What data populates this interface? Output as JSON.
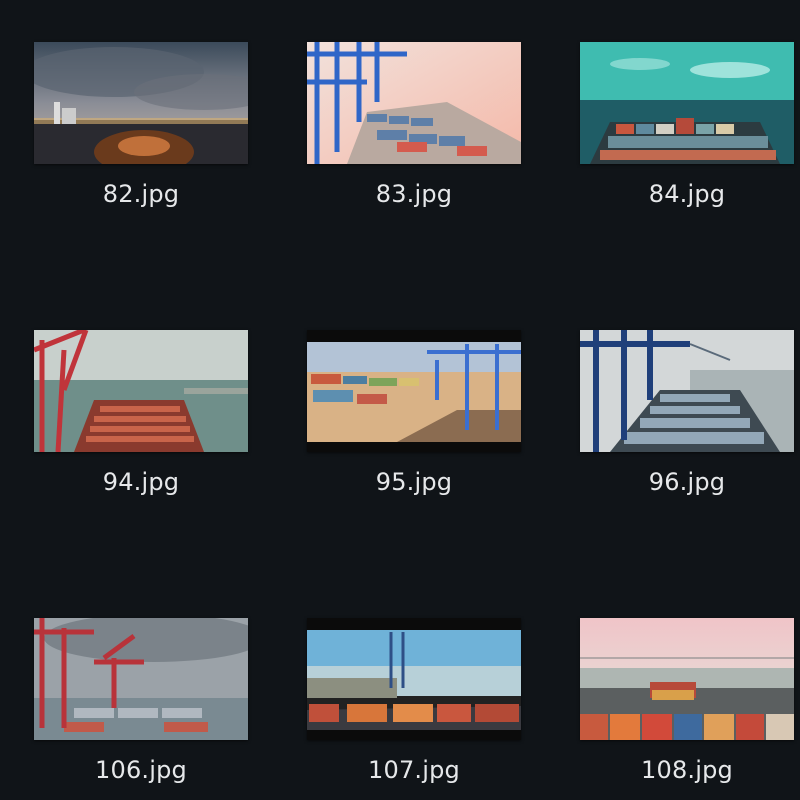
{
  "window": {
    "background": "#101418"
  },
  "files": [
    {
      "name": "82.jpg",
      "thumbnail": "harbor-night-cityscape"
    },
    {
      "name": "83.jpg",
      "thumbnail": "cranes-over-container-deck"
    },
    {
      "name": "84.jpg",
      "thumbnail": "container-ship-at-sea-teal"
    },
    {
      "name": "94.jpg",
      "thumbnail": "red-crane-ship-in-harbor"
    },
    {
      "name": "95.jpg",
      "thumbnail": "container-yard-with-cranes"
    },
    {
      "name": "96.jpg",
      "thumbnail": "blue-cranes-over-ship-deck"
    },
    {
      "name": "106.jpg",
      "thumbnail": "red-cranes-overcast-port"
    },
    {
      "name": "107.jpg",
      "thumbnail": "container-terminal-blue-sky"
    },
    {
      "name": "108.jpg",
      "thumbnail": "ship-bow-containers-pink-sky"
    }
  ]
}
